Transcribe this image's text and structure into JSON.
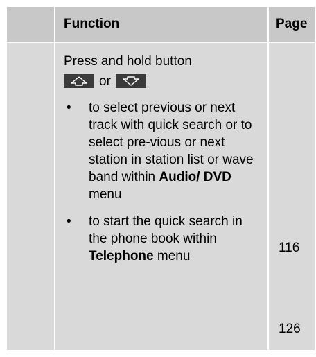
{
  "header": {
    "function_label": "Function",
    "page_label": "Page"
  },
  "intro": {
    "text": "Press and hold button",
    "or_text": "or",
    "up_button_icon": "up-arrow-key-icon",
    "down_button_icon": "down-arrow-key-icon"
  },
  "items": [
    {
      "text_before": "to select previous or next track with quick search or to select pre-vious or next station in station list or wave band within ",
      "bold_text": "Audio/ DVD",
      "text_after": " menu",
      "page": "116"
    },
    {
      "text_before": "to start the quick search in the phone book within ",
      "bold_text": "Telephone",
      "text_after": " menu",
      "page": "126"
    }
  ],
  "bullet_char": "•"
}
